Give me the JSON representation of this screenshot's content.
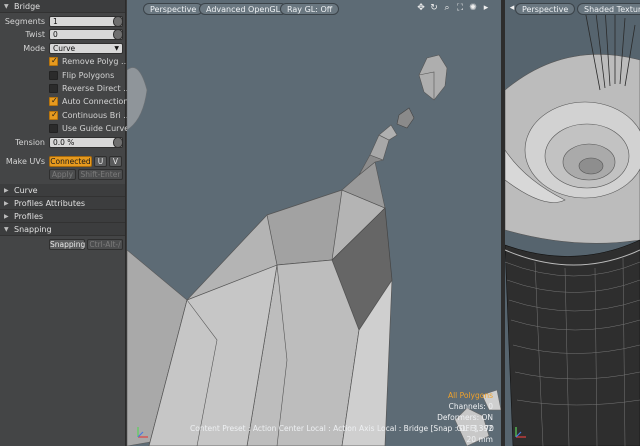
{
  "panel": {
    "bridge_header": "Bridge",
    "segments": {
      "label": "Segments",
      "value": "1"
    },
    "twist": {
      "label": "Twist",
      "value": "0"
    },
    "mode": {
      "label": "Mode",
      "value": "Curve"
    },
    "checks": [
      {
        "label": "Remove Polyg ...",
        "checked": true
      },
      {
        "label": "Flip Polygons",
        "checked": false
      },
      {
        "label": "Reverse Direct ...",
        "checked": false
      },
      {
        "label": "Auto Connection",
        "checked": true
      },
      {
        "label": "Continuous Bri ...",
        "checked": true
      },
      {
        "label": "Use Guide Curve",
        "checked": false
      }
    ],
    "tension": {
      "label": "Tension",
      "value": "0.0 %"
    },
    "make_uvs": {
      "label": "Make UVs",
      "connected": "Connected",
      "u": "U",
      "v": "V"
    },
    "apply": "Apply",
    "apply_shortcut": "Shift-Enter",
    "sections": [
      "Curve",
      "Profiles Attributes",
      "Profiles",
      "Snapping"
    ],
    "snapping_button": "Snapping",
    "snapping_shortcut": "Ctrl-Alt-/"
  },
  "viewport1": {
    "tabs": [
      "Perspective",
      "Advanced OpenGL",
      "Ray GL: Off"
    ],
    "icons": [
      "move-icon",
      "rotate-icon",
      "zoom-icon",
      "fit-icon",
      "settings-icon",
      "play-icon"
    ],
    "selection": "All Polygons",
    "channels": "Channels: 0",
    "deformers": "Deformers: ON",
    "gl": "GL: 3,392",
    "unit": "20 mm",
    "status": "Content Preset : Action Center Local : Action Axis Local : Bridge  [Snap : OFF]  : 70"
  },
  "viewport2": {
    "tabs": [
      "Perspective",
      "Shaded Texture"
    ]
  },
  "colors": {
    "accent": "#e69a1f",
    "viewport_bg": "#5d6b75",
    "panel_bg": "#444546"
  }
}
